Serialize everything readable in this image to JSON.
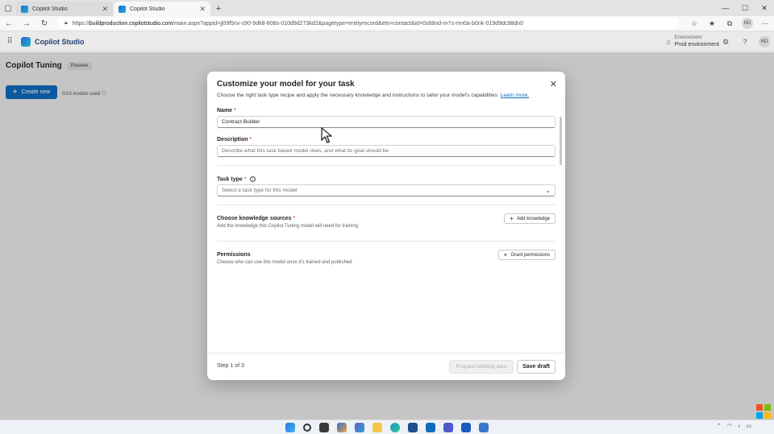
{
  "browser": {
    "tabs": [
      {
        "label": "Copilot Studio",
        "active": false
      },
      {
        "label": "Copilot Studio",
        "active": true
      }
    ],
    "url_prefix": "https://",
    "url_host": "buildproduction.copilotstudio.com",
    "url_path": "/main.aspx?appid=jj09f5nv-s90-9dk8-808s-010d9d273kd2&pagetype=entityrecord&etn=contact&id=0s88nd-rn7s-mn0a-b0nk-019d9dc98dn0",
    "profile_initials": "MJ"
  },
  "app": {
    "name": "Copilot Studio",
    "environment_label": "Environment",
    "environment_value": "Prod environment",
    "user_initials": "MJ"
  },
  "page": {
    "title": "Copilot Tuning",
    "badge": "Preview",
    "create_label": "Create new",
    "models_used": "0/10 models used"
  },
  "dialog": {
    "title": "Customize your model for your task",
    "subtitle": "Choose the right task type recipe and apply the necessary knowledge and instructions to tailor your model's capabilities.",
    "learn_more": "Learn more.",
    "name_label": "Name",
    "name_value": "Contract Builder",
    "description_label": "Description",
    "description_placeholder": "Describe what this task based model does, and what its goal should be",
    "task_type_label": "Task type",
    "task_type_placeholder": "Select a task type for this model",
    "knowledge_label": "Choose knowledge sources",
    "knowledge_help": "Add the knowledge this Copilot Tuning model will need for training",
    "add_knowledge": "Add knowledge",
    "permissions_label": "Permissions",
    "permissions_help": "Choose who can use this model once it's trained and published",
    "grant_permissions": "Grant permissions",
    "step": "Step 1 of 3",
    "prepare_label": "Prepare labeling data",
    "save_label": "Save draft",
    "required_mark": "*"
  },
  "colors": {
    "primary": "#0f6cbd",
    "required": "#c50f1f"
  }
}
